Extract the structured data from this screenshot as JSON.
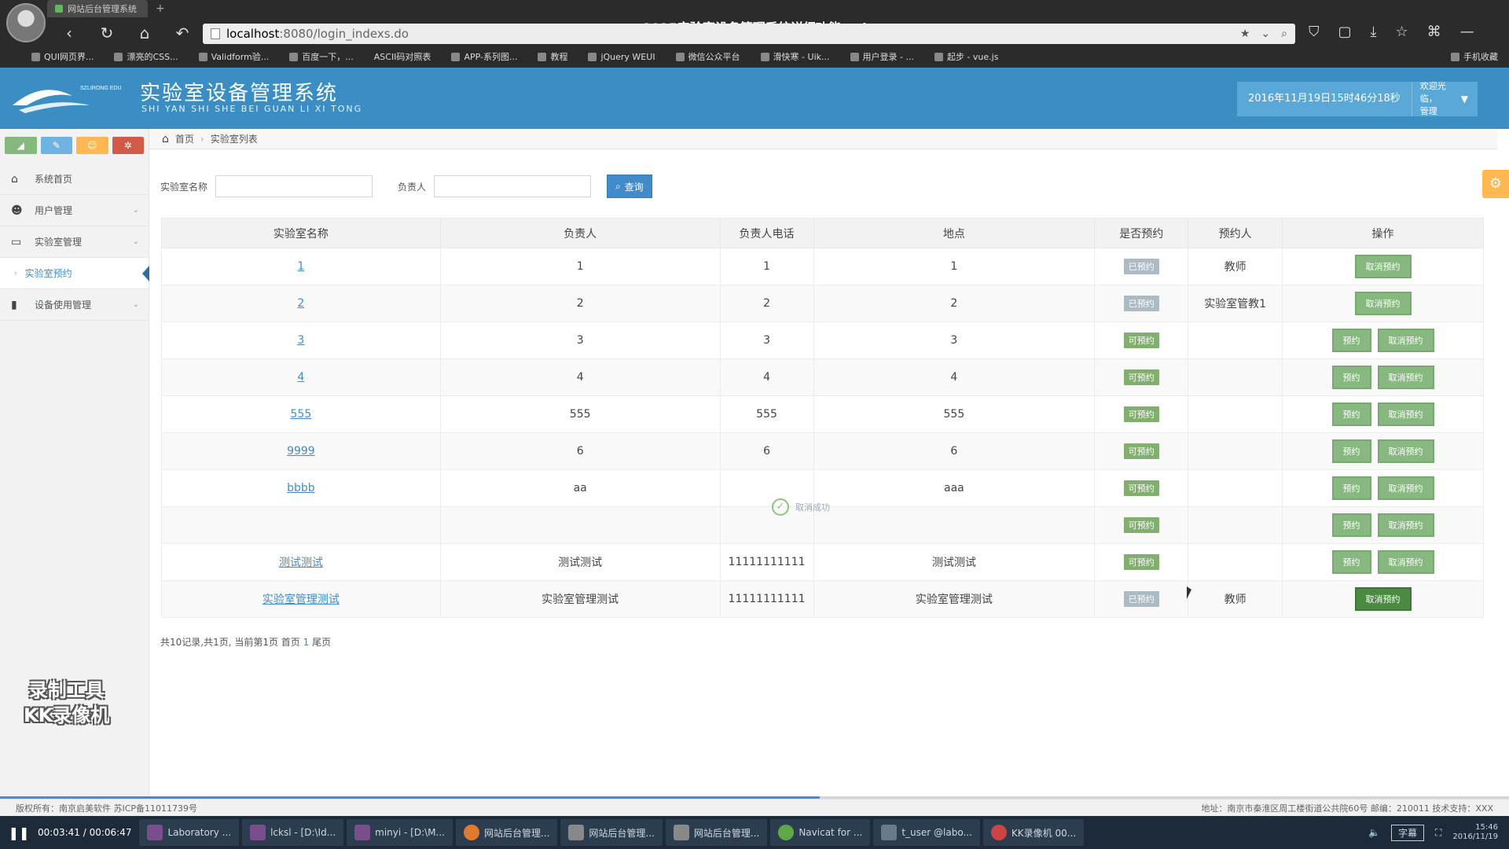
{
  "browser": {
    "tab_title": "网站后台管理系统",
    "video_title": "1025实验室设备管理系统详细功能.avi",
    "url_host": "localhost",
    "url_path": ":8080/login_indexs.do",
    "bookmarks": [
      "QUI网页界...",
      "漂亮的CSS...",
      "Validform验...",
      "百度一下，...",
      "ASCII码对照表",
      "APP-系列图...",
      "教程",
      "jQuery WEUI",
      "微信公众平台",
      "滑快寒 - Uik...",
      "用户登录 - ...",
      "起步 - vue.js"
    ],
    "bookmark_right": "手机收藏"
  },
  "header": {
    "logo_text": "SZLIRONG EDU",
    "title": "实验室设备管理系统",
    "subtitle": "SHI YAN SHI SHE BEI GUAN LI XI TONG",
    "datetime": "2016年11月19日15时46分18秒",
    "welcome_line1": "欢迎光临，",
    "welcome_line2": "管理"
  },
  "sidebar": {
    "items": [
      {
        "label": "系统首页",
        "icon": "home-icon"
      },
      {
        "label": "用户管理",
        "icon": "users-icon"
      },
      {
        "label": "实验室管理",
        "icon": "desktop-icon"
      },
      {
        "label": "实验室预约",
        "icon": "dot-icon"
      },
      {
        "label": "设备使用管理",
        "icon": "bookmark-icon"
      }
    ],
    "watermark_line1": "录制工具",
    "watermark_line2": "KK录像机"
  },
  "breadcrumb": {
    "home": "首页",
    "current": "实验室列表"
  },
  "search": {
    "lab_name_label": "实验室名称",
    "lab_name_value": "",
    "manager_label": "负责人",
    "manager_value": "",
    "button": "查询"
  },
  "table": {
    "headers": [
      "实验室名称",
      "负责人",
      "负责人电话",
      "地点",
      "是否预约",
      "预约人",
      "操作"
    ],
    "rows": [
      {
        "name": "1",
        "manager": "1",
        "phone": "1",
        "location": "1",
        "status": "已预约",
        "booker": "教师"
      },
      {
        "name": "2",
        "manager": "2",
        "phone": "2",
        "location": "2",
        "status": "已预约",
        "booker": "实验室管教1"
      },
      {
        "name": "3",
        "manager": "3",
        "phone": "3",
        "location": "3",
        "status": "可预约",
        "booker": ""
      },
      {
        "name": "4",
        "manager": "4",
        "phone": "4",
        "location": "4",
        "status": "可预约",
        "booker": ""
      },
      {
        "name": "555",
        "manager": "555",
        "phone": "555",
        "location": "555",
        "status": "可预约",
        "booker": ""
      },
      {
        "name": "9999",
        "manager": "6",
        "phone": "6",
        "location": "6",
        "status": "可预约",
        "booker": ""
      },
      {
        "name": "bbbb",
        "manager": "aa",
        "phone": "",
        "location": "aaa",
        "status": "可预约",
        "booker": ""
      },
      {
        "name": "",
        "manager": "",
        "phone": "",
        "location": "",
        "status": "可预约",
        "booker": ""
      },
      {
        "name": "测试测试",
        "manager": "测试测试",
        "phone": "11111111111",
        "location": "测试测试",
        "status": "可预约",
        "booker": ""
      },
      {
        "name": "实验室管理测试",
        "manager": "实验室管理测试",
        "phone": "11111111111",
        "location": "实验室管理测试",
        "status": "已预约",
        "booker": "教师"
      }
    ],
    "book_label": "预约",
    "cancel_label": "取消预约"
  },
  "toast": {
    "message": "取消成功"
  },
  "pagination": {
    "summary": "共10记录,共1页, 当前第1页 首页",
    "page": "1",
    "last": "尾页"
  },
  "footer": {
    "left": "版权所有：南京启美软件 苏ICP备11011739号",
    "right": "地址：南京市秦淮区周工楼街道公共院60号 邮编：210011 技术支持：XXX"
  },
  "video": {
    "time": "00:03:41 / 00:06:47",
    "progress": 0.543,
    "subtitle_label": "字幕"
  },
  "taskbar": {
    "apps": [
      "Laboratory ...",
      "lcksl - [D:\\Id...",
      "minyi - [D:\\M...",
      "网站后台管理...",
      "网站后台管理...",
      "网站后台管理...",
      "Navicat for ...",
      "t_user @labo...",
      "KK录像机 00..."
    ],
    "clock_time": "15:46",
    "clock_date": "2016/11/19"
  },
  "colors": {
    "header_bg": "#3a8ec4",
    "booked_tag": "#abbac3",
    "free_tag": "#82af6f",
    "action_button": "#87b87f"
  }
}
